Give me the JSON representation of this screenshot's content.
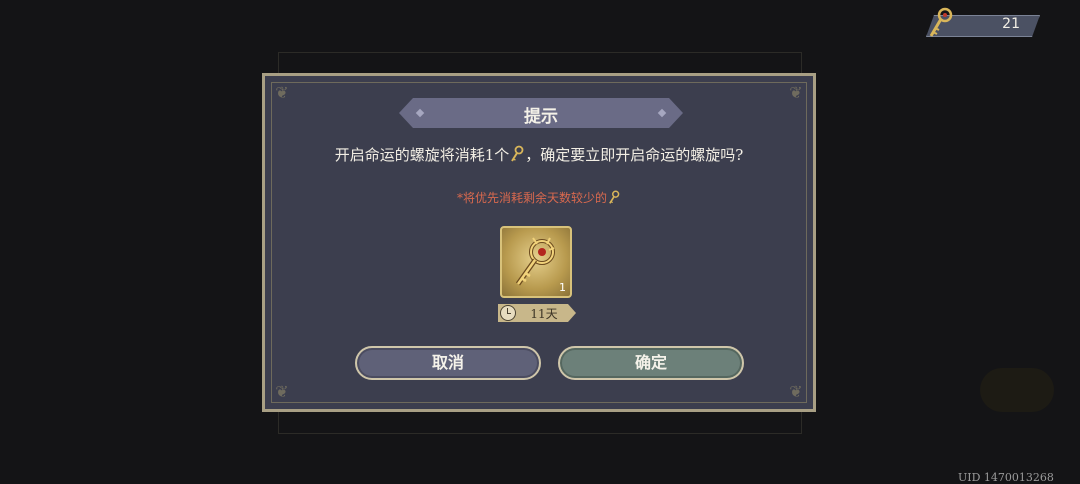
{
  "currency": {
    "value": "21",
    "icon": "golden-key-icon"
  },
  "uid_text": "UID 1470013268",
  "dialog": {
    "title": "提示",
    "message_part1": "开启命运的螺旋将消耗1个",
    "message_part2": "，确定要立即开启命运的螺旋吗?",
    "note": "*将优先消耗剩余天数较少的",
    "item": {
      "count": "1",
      "timer": "11天",
      "icon": "fate-key-icon"
    },
    "cancel_label": "取消",
    "confirm_label": "确定"
  },
  "colors": {
    "note": "#d9694e",
    "frame": "#a89f84",
    "panel": "#3c3e4e"
  }
}
